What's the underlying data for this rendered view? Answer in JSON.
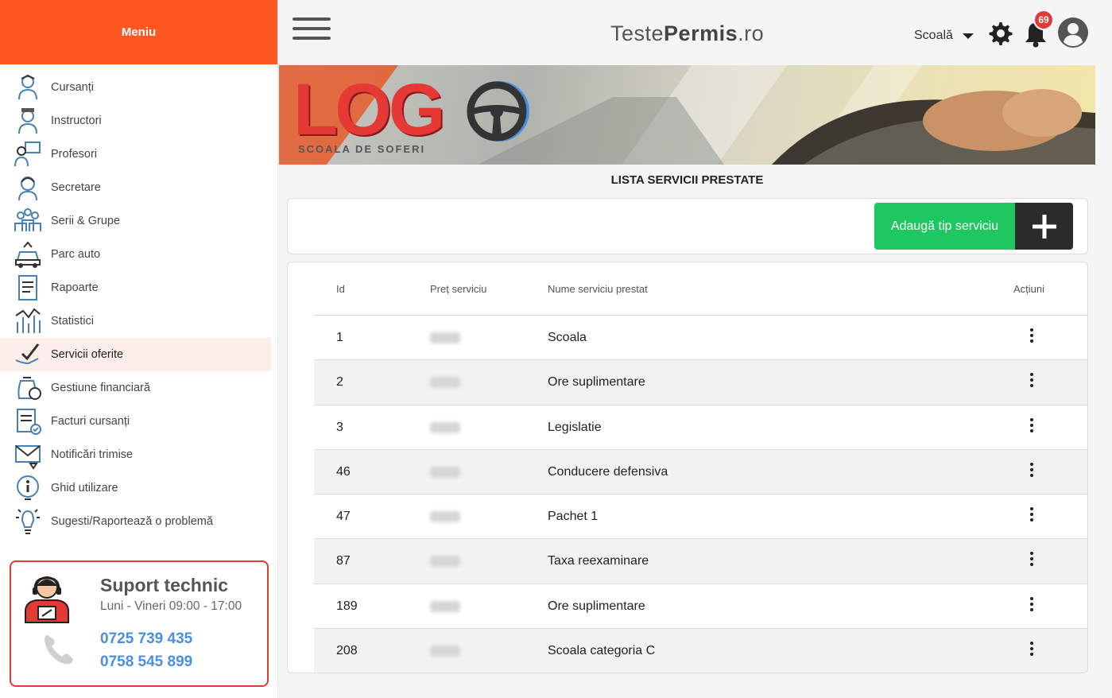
{
  "sidebar": {
    "header": "Meniu",
    "items": [
      {
        "label": "Cursanți",
        "icon": "student-icon"
      },
      {
        "label": "Instructori",
        "icon": "instructor-icon"
      },
      {
        "label": "Profesori",
        "icon": "teacher-icon"
      },
      {
        "label": "Secretare",
        "icon": "secretary-icon"
      },
      {
        "label": "Serii & Grupe",
        "icon": "groups-icon"
      },
      {
        "label": "Parc auto",
        "icon": "car-icon"
      },
      {
        "label": "Rapoarte",
        "icon": "report-icon"
      },
      {
        "label": "Statistici",
        "icon": "statistics-icon"
      },
      {
        "label": "Servicii oferite",
        "icon": "services-icon"
      },
      {
        "label": "Gestiune financiară",
        "icon": "finance-icon"
      },
      {
        "label": "Facturi cursanți",
        "icon": "invoice-icon"
      },
      {
        "label": "Notificări trimise",
        "icon": "notification-mail-icon"
      },
      {
        "label": "Ghid utilizare",
        "icon": "info-guide-icon"
      },
      {
        "label": "Sugesti/Raportează o problemă",
        "icon": "idea-bulb-icon"
      }
    ],
    "active_item": "Servicii oferite"
  },
  "support": {
    "title": "Suport technic",
    "hours": "Luni - Vineri 09:00 - 17:00",
    "phone1": "0725 739 435",
    "phone2": "0758 545 899"
  },
  "topbar": {
    "brand_light": "Teste",
    "brand_bold": "Permis",
    "brand_suffix": ".ro",
    "school_select": "Scoală",
    "notifications_count": "69"
  },
  "banner": {
    "logo": "LOG",
    "subtitle": "SCOALA DE SOFERI"
  },
  "page": {
    "title": "LISTA SERVICII PRESTATE",
    "add_button": "Adaugă tip serviciu"
  },
  "table": {
    "columns": [
      "Id",
      "Preț serviciu",
      "Nume serviciu prestat",
      "Acțiuni"
    ],
    "rows": [
      {
        "id": "1",
        "name": "Scoala"
      },
      {
        "id": "2",
        "name": "Ore suplimentare"
      },
      {
        "id": "3",
        "name": "Legislatie"
      },
      {
        "id": "46",
        "name": "Conducere defensiva"
      },
      {
        "id": "47",
        "name": "Pachet 1"
      },
      {
        "id": "87",
        "name": "Taxa reexaminare"
      },
      {
        "id": "189",
        "name": "Ore suplimentare"
      },
      {
        "id": "208",
        "name": "Scoala categoria C"
      }
    ]
  },
  "colors": {
    "accent": "#ff5722",
    "add_button": "#1ec760",
    "badge": "#e53935",
    "phone": "#4a90e2"
  }
}
